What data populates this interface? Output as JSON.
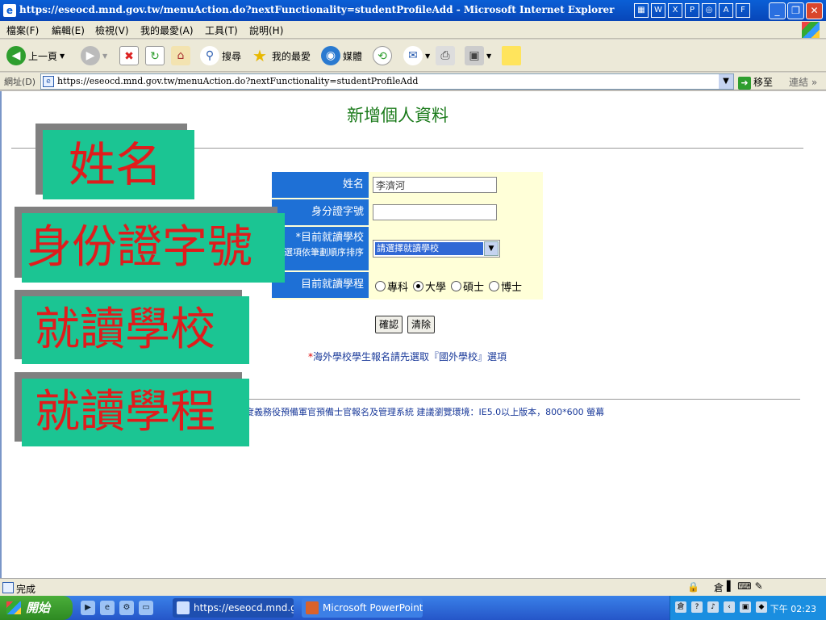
{
  "window": {
    "title": "https://eseocd.mnd.gov.tw/menuAction.do?nextFunctionality=studentProfileAdd - Microsoft Internet Explorer"
  },
  "menu": [
    "檔案(F)",
    "編輯(E)",
    "檢視(V)",
    "我的最愛(A)",
    "工具(T)",
    "說明(H)"
  ],
  "toolbar": {
    "back_label": "上一頁",
    "search_label": "搜尋",
    "favorites_label": "我的最愛",
    "media_label": "媒體"
  },
  "address": {
    "label": "網址(D)",
    "url": "https://eseocd.mnd.gov.tw/menuAction.do?nextFunctionality=studentProfileAdd",
    "go_label": "移至",
    "links_label": "連結"
  },
  "page": {
    "title": "新增個人資料",
    "form": {
      "name_label": "姓名",
      "name_value": "李濟河",
      "id_label": "身分證字號",
      "id_value": "",
      "school_label": "*目前就讀學校",
      "school_hint": "(選項依筆劃順序排序",
      "school_selected": "請選擇就讀學校",
      "program_label": "目前就讀學程",
      "programs": [
        {
          "label": "專科",
          "checked": false
        },
        {
          "label": "大學",
          "checked": true
        },
        {
          "label": "碩士",
          "checked": false
        },
        {
          "label": "博士",
          "checked": false
        }
      ]
    },
    "confirm_label": "確認",
    "clear_label": "清除",
    "note_star": "*",
    "note_text": "海外學校學生報名請先選取『國外學校』選項",
    "footer": "度義務役預備軍官預備士官報名及管理系統 建議瀏覽環境：IE5.0以上版本，800*600 螢幕"
  },
  "overlays": [
    {
      "text": "姓名"
    },
    {
      "text": "身份證字號"
    },
    {
      "text": "就讀學校"
    },
    {
      "text": "就讀學程"
    }
  ],
  "status": {
    "text": "完成"
  },
  "taskbar": {
    "start_label": "開始",
    "task1": "https://eseocd.mnd.gov...",
    "task2": "Microsoft PowerPoint ...",
    "clock": "下午 02:23"
  },
  "colors": {
    "label_bg": "#1e70d6",
    "form_bg": "#ffffd8",
    "title_green": "#1a7a1a",
    "overlay_bg": "#1bc593",
    "overlay_text": "#e01c1c"
  }
}
